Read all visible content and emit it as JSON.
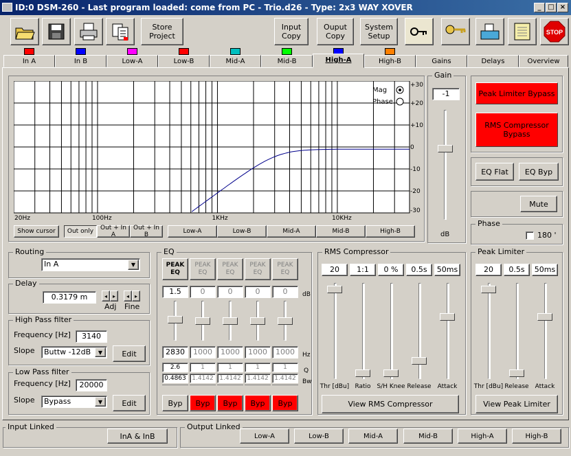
{
  "window": {
    "title": "ID:0 DSM-260 - Last program loaded: come from PC - Trio.d26 - Type: 2x3 WAY XOVER",
    "min": "_",
    "max": "□",
    "close": "×"
  },
  "toolbar": {
    "store": "Store\nProject",
    "input_copy": "Input\nCopy",
    "output_copy": "Ouput\nCopy",
    "system_setup": "System\nSetup",
    "stop": "STOP"
  },
  "tabs": [
    {
      "label": "In A",
      "color": "#ff0000"
    },
    {
      "label": "In B",
      "color": "#0000ff"
    },
    {
      "label": "Low-A",
      "color": "#ff00ff"
    },
    {
      "label": "Low-B",
      "color": "#ff0000"
    },
    {
      "label": "Mid-A",
      "color": "#00c0c0"
    },
    {
      "label": "Mid-B",
      "color": "#00ff00"
    },
    {
      "label": "High-A",
      "color": "#0000ff"
    },
    {
      "label": "High-B",
      "color": "#ff8000"
    },
    {
      "label": "Gains"
    },
    {
      "label": "Delays"
    },
    {
      "label": "Overview"
    }
  ],
  "graph": {
    "mag": "Mag",
    "phase": "Phase",
    "ylabels": [
      "+30",
      "+20",
      "+10",
      "0",
      "-10",
      "-20",
      "-30"
    ],
    "xlabels": [
      "20Hz",
      "100Hz",
      "1KHz",
      "10KHz"
    ]
  },
  "graph_buttons": {
    "show_cursor": "Show cursor",
    "out_only": "Out only",
    "out_in_a": "Out + In A",
    "out_in_b": "Out + In B",
    "low_a": "Low-A",
    "low_b": "Low-B",
    "mid_a": "Mid-A",
    "mid_b": "Mid-B",
    "high_b": "High-B"
  },
  "gain": {
    "title": "Gain",
    "value": "-1",
    "unit": "dB",
    "level": 0.35
  },
  "peak_bypass": "Peak Limiter Bypass",
  "rms_bypass": "RMS Compressor\nBypass",
  "eq_flat": "EQ Flat",
  "eq_byp": "EQ Byp",
  "mute": "Mute",
  "phase": {
    "title": "Phase",
    "label": "180 '"
  },
  "routing": {
    "title": "Routing",
    "value": "In A"
  },
  "delay": {
    "title": "Delay",
    "value": "0.3179 m",
    "adj": "Adj",
    "fine": "Fine"
  },
  "hpf": {
    "title": "High Pass filter",
    "freq_label": "Frequency [Hz]",
    "freq": "3140",
    "slope_label": "Slope",
    "slope": "Buttw -12dB",
    "edit": "Edit"
  },
  "lpf": {
    "title": "Low Pass filter",
    "freq_label": "Frequency [Hz]",
    "freq": "20000",
    "slope_label": "Slope",
    "slope": "Bypass",
    "edit": "Edit"
  },
  "eq": {
    "title": "EQ",
    "band_label": "PEAK\nEQ",
    "gains": [
      "1.5",
      "0",
      "0",
      "0",
      "0"
    ],
    "freqs": [
      "2830",
      "1000",
      "1000",
      "1000",
      "1000"
    ],
    "qs": [
      "2.6",
      "1",
      "1",
      "1",
      "1"
    ],
    "bws": [
      "0.4863",
      "1.4142",
      "1.4142",
      "1.4142",
      "1.4142"
    ],
    "db": "dB",
    "hz": "Hz",
    "q": "Q",
    "bw": "Bw",
    "byp": "Byp"
  },
  "rms": {
    "title": "RMS Compressor",
    "values": [
      "20",
      "1:1",
      "0 %",
      "0.5s",
      "50ms"
    ],
    "labels": [
      "Thr [dBu]",
      "Ratio",
      "S/H Knee",
      "Release",
      "Attack"
    ],
    "view": "View RMS Compressor"
  },
  "peak": {
    "title": "Peak Limiter",
    "values": [
      "20",
      "0.5s",
      "50ms"
    ],
    "labels": [
      "Thr [dBu]",
      "Release",
      "Attack"
    ],
    "view": "View Peak Limiter"
  },
  "input_linked": {
    "title": "Input Linked",
    "button": "InA & InB"
  },
  "output_linked": {
    "title": "Output Linked",
    "buttons": [
      "Low-A",
      "Low-B",
      "Mid-A",
      "Mid-B",
      "High-A",
      "High-B"
    ]
  }
}
